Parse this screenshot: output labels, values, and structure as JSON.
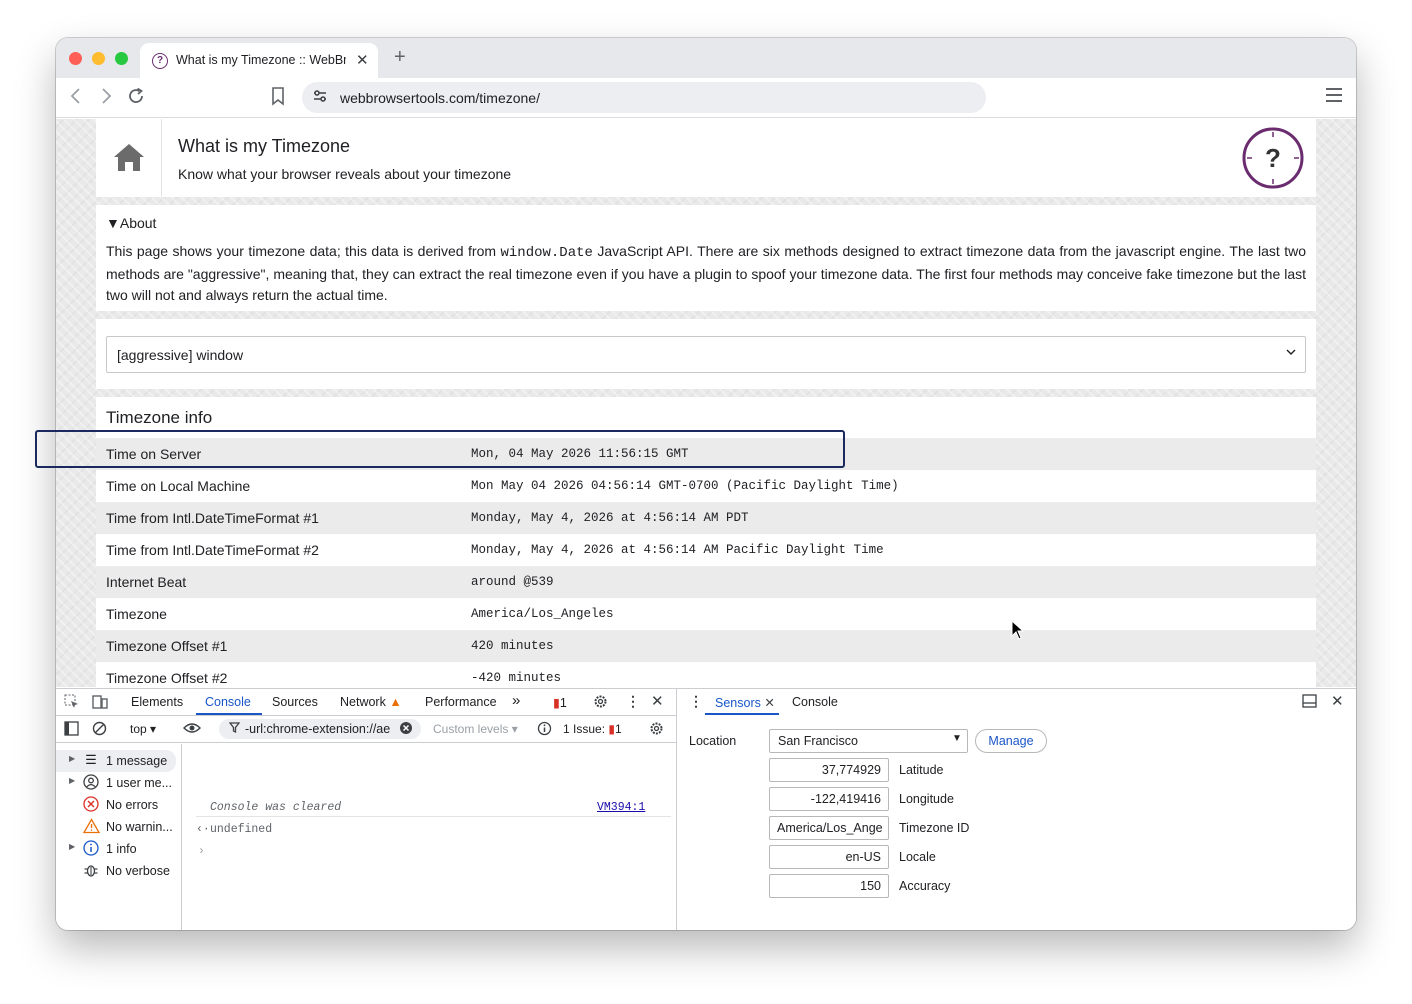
{
  "browser": {
    "tab_title": "What is my Timezone :: WebBr",
    "tab_favicon": "?",
    "url": "webbrowsertools.com/timezone/"
  },
  "page": {
    "title": "What is my Timezone",
    "subtitle": "Know what your browser reveals about your timezone",
    "clock_mark": "?",
    "about": {
      "summary": "About",
      "text_before": "This page shows your timezone data; this data is derived from ",
      "code": "window.Date",
      "text_after": " JavaScript API. There are six methods designed to extract timezone data from the javascript engine. The last two methods are \"aggressive\", meaning that, they can extract the real timezone even if you have a plugin to spoof your timezone data. The first four methods may conceive fake timezone but the last two will not and always return the actual time."
    },
    "method_select": "[aggressive] window",
    "info_title": "Timezone info",
    "rows": [
      {
        "label": "Time on Server",
        "value": "Mon, 04 May 2026 11:56:15 GMT"
      },
      {
        "label": "Time on Local Machine",
        "value": "Mon May 04 2026 04:56:14 GMT-0700 (Pacific Daylight Time)"
      },
      {
        "label": "Time from Intl.DateTimeFormat #1",
        "value": "Monday, May 4, 2026 at 4:56:14 AM PDT"
      },
      {
        "label": "Time from Intl.DateTimeFormat #2",
        "value": "Monday, May 4, 2026 at 4:56:14 AM Pacific Daylight Time"
      },
      {
        "label": "Internet Beat",
        "value": "around @539"
      },
      {
        "label": "Timezone",
        "value": "America/Los_Angeles"
      },
      {
        "label": "Timezone Offset #1",
        "value": "420 minutes"
      },
      {
        "label": "Timezone Offset #2",
        "value": "-420 minutes"
      }
    ]
  },
  "devtools": {
    "tabs": [
      "Elements",
      "Console",
      "Sources",
      "Network",
      "Performance"
    ],
    "active_tab": "Console",
    "more_tabs": "»",
    "error_badge": "1",
    "context": "top",
    "filter_text": "-url:chrome-extension://ae",
    "levels": "Custom levels",
    "issues_label": "1 Issue:",
    "issues_count": "1",
    "sidebar": [
      {
        "label": "1 message",
        "icon": "list-icon"
      },
      {
        "label": "1 user me...",
        "icon": "user-icon"
      },
      {
        "label": "No errors",
        "icon": "error-icon"
      },
      {
        "label": "No warnin...",
        "icon": "warning-icon"
      },
      {
        "label": "1 info",
        "icon": "info-icon"
      },
      {
        "label": "No verbose",
        "icon": "bug-icon"
      }
    ],
    "console": {
      "cleared": "Console was cleared",
      "link": "VM394:1",
      "result": "undefined"
    },
    "drawer_tabs": [
      "Sensors",
      "Console"
    ],
    "sensors": {
      "location_label": "Location",
      "location_value": "San Francisco",
      "manage_label": "Manage",
      "latitude": "37,774929",
      "latitude_label": "Latitude",
      "longitude": "-122,419416",
      "longitude_label": "Longitude",
      "timezone_id": "America/Los_Ange",
      "timezone_label": "Timezone ID",
      "locale": "en-US",
      "locale_label": "Locale",
      "accuracy": "150",
      "accuracy_label": "Accuracy"
    }
  },
  "colors": {
    "accent": "#1a56c8",
    "brand": "#6a2c6f",
    "highlight_border": "#1a2a5e"
  }
}
